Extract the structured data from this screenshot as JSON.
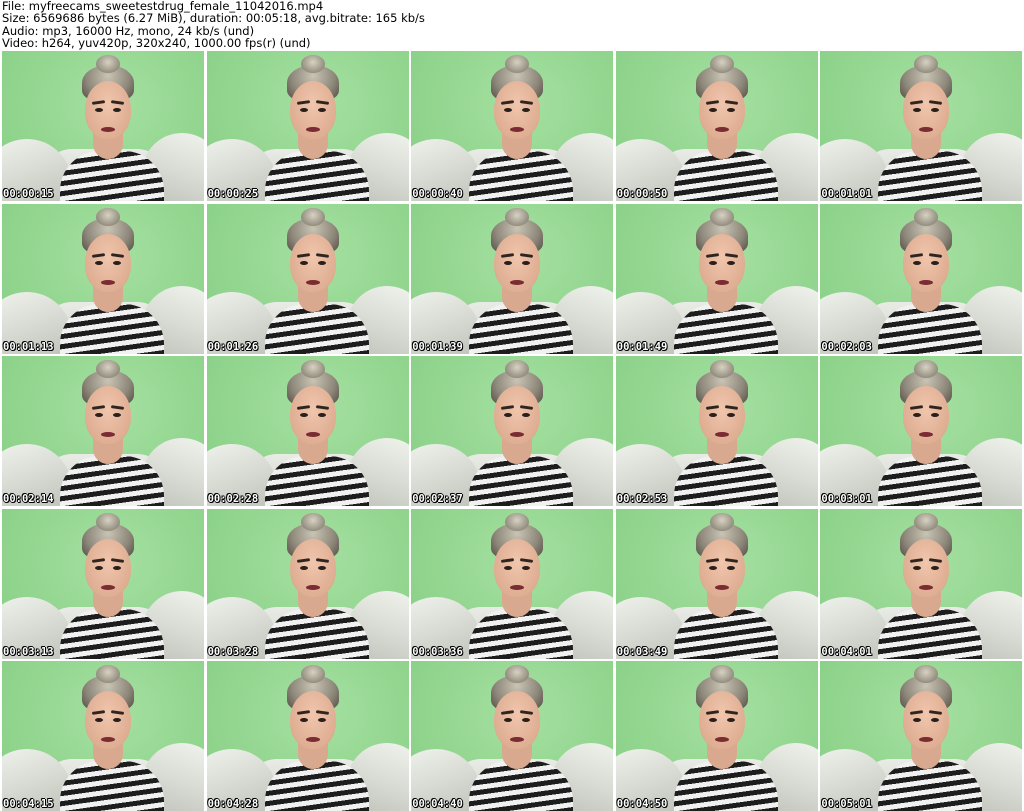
{
  "header": {
    "file_line": "File: myfreecams_sweetestdrug_female_11042016.mp4",
    "size_line": "Size: 6569686 bytes (6.27 MiB), duration: 00:05:18, avg.bitrate: 165 kb/s",
    "audio_line": "Audio: mp3, 16000 Hz, mono, 24 kb/s (und)",
    "video_line": "Video: h264, yuv420p, 320x240, 1000.00 fps(r) (und)"
  },
  "colors": {
    "wall_green": "#93d690",
    "timestamp_text": "#ffffff",
    "timestamp_outline": "#000000"
  },
  "thumbnails": [
    {
      "time": "00:00:15"
    },
    {
      "time": "00:00:25"
    },
    {
      "time": "00:00:40"
    },
    {
      "time": "00:00:50"
    },
    {
      "time": "00:01:01"
    },
    {
      "time": "00:01:13"
    },
    {
      "time": "00:01:26"
    },
    {
      "time": "00:01:39"
    },
    {
      "time": "00:01:49"
    },
    {
      "time": "00:02:03"
    },
    {
      "time": "00:02:14"
    },
    {
      "time": "00:02:28"
    },
    {
      "time": "00:02:37"
    },
    {
      "time": "00:02:53"
    },
    {
      "time": "00:03:01"
    },
    {
      "time": "00:03:13"
    },
    {
      "time": "00:03:28"
    },
    {
      "time": "00:03:36"
    },
    {
      "time": "00:03:49"
    },
    {
      "time": "00:04:01"
    },
    {
      "time": "00:04:15"
    },
    {
      "time": "00:04:28"
    },
    {
      "time": "00:04:40"
    },
    {
      "time": "00:04:50"
    },
    {
      "time": "00:05:01"
    }
  ]
}
